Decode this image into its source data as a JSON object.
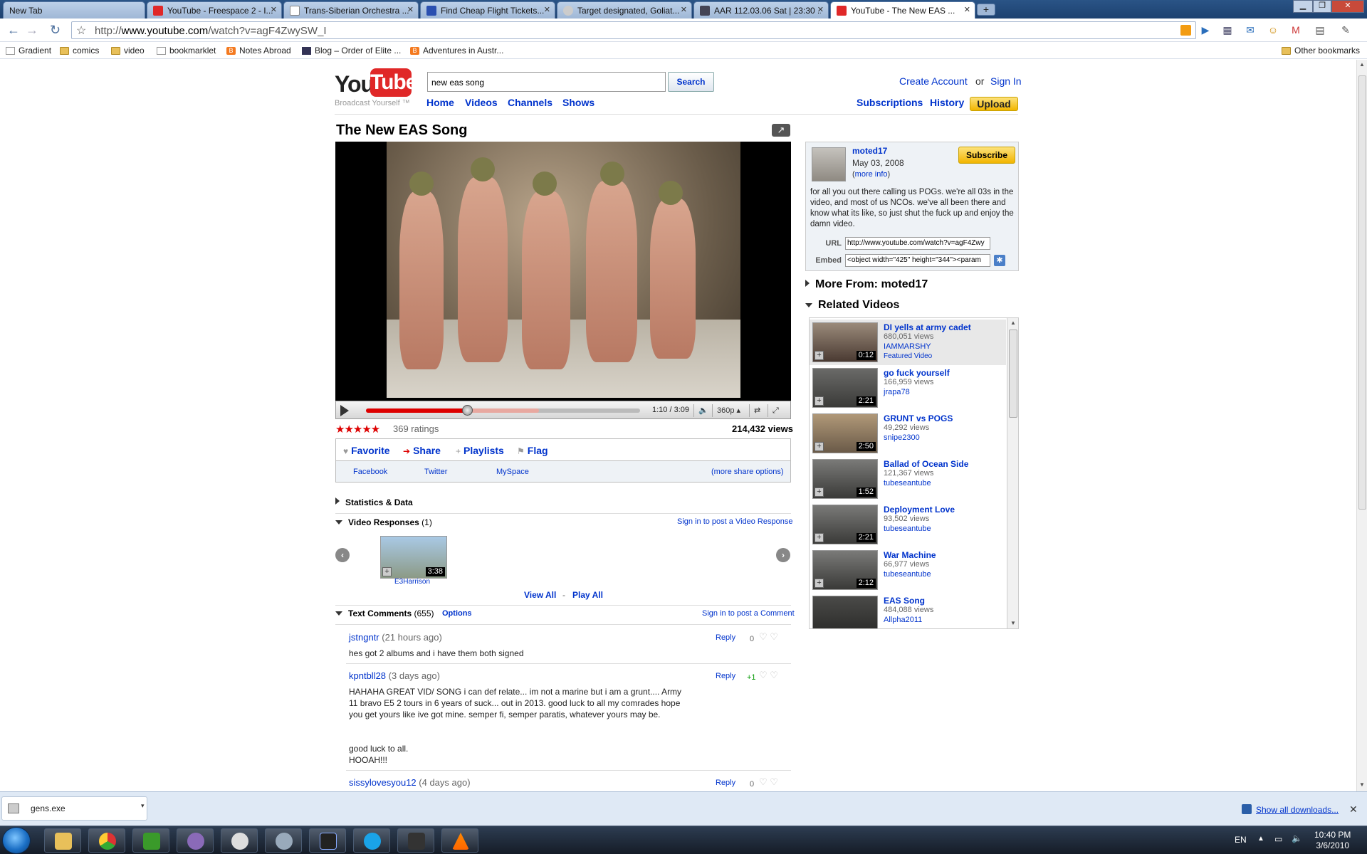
{
  "browser": {
    "tabs": [
      {
        "label": "New Tab"
      },
      {
        "label": "YouTube - Freespace 2 - I..."
      },
      {
        "label": "Trans-Siberian Orchestra ..."
      },
      {
        "label": "Find Cheap Flight Tickets..."
      },
      {
        "label": "Target designated, Goliat..."
      },
      {
        "label": "AAR 112.03.06 Sat | 23:30 ..."
      },
      {
        "label": "YouTube - The New EAS ..."
      }
    ],
    "url_host": "www.youtube.com",
    "url_prefix": "http://",
    "url_path": "/watch?v=agF4ZwySW_I",
    "bookmarks": [
      {
        "label": "Gradient"
      },
      {
        "label": "comics"
      },
      {
        "label": "video"
      },
      {
        "label": "bookmarklet"
      },
      {
        "label": "Notes Abroad"
      },
      {
        "label": "Blog – Order of Elite ..."
      },
      {
        "label": "Adventures in Austr..."
      }
    ],
    "other_bookmarks": "Other bookmarks"
  },
  "youtube": {
    "logo_you": "You",
    "logo_tube": "Tube",
    "tagline": "Broadcast Yourself ™",
    "search_value": "new eas song",
    "search_button": "Search",
    "nav": [
      "Home",
      "Videos",
      "Channels",
      "Shows"
    ],
    "create_account": "Create Account",
    "or": "or",
    "sign_in": "Sign In",
    "subscriptions": "Subscriptions",
    "history": "History",
    "upload": "Upload"
  },
  "video": {
    "title": "The New EAS Song",
    "time": "1:10 / 3:09",
    "quality": "360p",
    "progress_played_fraction": 0.37,
    "progress_loaded_fraction": 0.63,
    "ratings": "369 ratings",
    "views": "214,432 views",
    "actions": {
      "favorite": "Favorite",
      "share": "Share",
      "playlists": "Playlists",
      "flag": "Flag"
    },
    "share": {
      "facebook": "Facebook",
      "twitter": "Twitter",
      "myspace": "MySpace",
      "more": "(more share options)"
    },
    "stats": "Statistics & Data",
    "responses_label": "Video Responses",
    "responses_count": "(1)",
    "responses_signin": "Sign in to post a Video Response",
    "response_duration": "3:38",
    "response_user": "E3Harrison",
    "view_all": "View All",
    "dash": "-",
    "play_all": "Play All",
    "comments_label": "Text Comments",
    "comments_count": "(655)",
    "options": "Options",
    "comments_signin": "Sign in to post a Comment"
  },
  "comments": [
    {
      "user": "jstngntr",
      "time": "(21 hours ago)",
      "text": "hes got 2 albums and i have them both signed",
      "reply": "Reply",
      "score": "0"
    },
    {
      "user": "kpntbll28",
      "time": "(3 days ago)",
      "text": "HAHAHA GREAT VID/ SONG i can def relate... im not a marine but i am a grunt.... Army 11 bravo E5 2 tours in 6 years of suck... out in 2013. good luck to all my comrades hope you get yours like ive got mine. semper fi, semper paratis, whatever yours may be.",
      "text2": "good luck to all.",
      "text3": "HOOAH!!!",
      "reply": "Reply",
      "score": "+1"
    },
    {
      "user": "sissylovesyou12",
      "time": "(4 days ago)",
      "reply": "Reply",
      "score": "0"
    }
  ],
  "uploader": {
    "name": "moted17",
    "date": "May 03, 2008",
    "more_info": "more info",
    "subscribe": "Subscribe",
    "description": "for all you out there calling us POGs. we're all 03s in the video, and most of us NCOs. we've all been there and know what its like, so just shut the fuck up and enjoy the damn video.",
    "url_label": "URL",
    "url_value": "http://www.youtube.com/watch?v=agF4Zwy",
    "embed_label": "Embed",
    "embed_value": "<object width=\"425\" height=\"344\"><param"
  },
  "more_from": "More From: moted17",
  "related_header": "Related Videos",
  "related": [
    {
      "title": "DI yells at army cadet",
      "views": "680,051 views",
      "user": "IAMMARSHY",
      "featured": "Featured Video",
      "duration": "0:12"
    },
    {
      "title": "go fuck yourself",
      "views": "166,959 views",
      "user": "jrapa78",
      "duration": "2:21"
    },
    {
      "title": "GRUNT vs POGS",
      "views": "49,292 views",
      "user": "snipe2300",
      "duration": "2:50"
    },
    {
      "title": "Ballad of Ocean Side",
      "views": "121,367 views",
      "user": "tubeseantube",
      "duration": "1:52"
    },
    {
      "title": "Deployment Love",
      "views": "93,502 views",
      "user": "tubeseantube",
      "duration": "2:21"
    },
    {
      "title": "War Machine",
      "views": "66,977 views",
      "user": "tubeseantube",
      "duration": "2:12"
    },
    {
      "title": "EAS Song",
      "views": "484,088 views",
      "user": "Allpha2011"
    }
  ],
  "downloads": {
    "file": "gens.exe",
    "show_all": "Show all downloads..."
  },
  "taskbar": {
    "lang": "EN",
    "time": "10:40 PM",
    "date": "3/6/2010"
  },
  "colors": {
    "youtube_red": "#e02828",
    "link_blue": "#0033cc",
    "upload_yellow": "#f2b500"
  }
}
